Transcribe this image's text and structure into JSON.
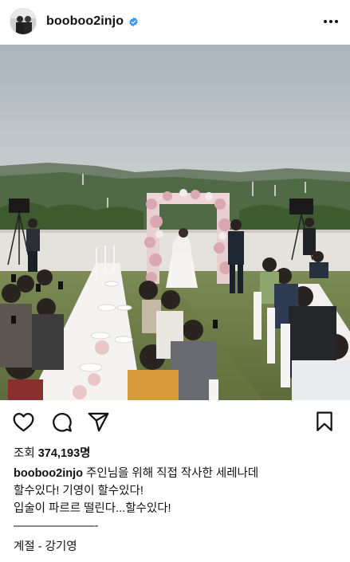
{
  "post": {
    "username": "booboo2injo",
    "verified": true
  },
  "icons": {
    "avatar": "avatar-photo",
    "verified": "verified-badge-icon",
    "more": "more-options-icon",
    "like": "heart-icon",
    "comment": "comment-icon",
    "share": "share-paper-plane-icon",
    "save": "bookmark-icon"
  },
  "colors": {
    "verified_badge": "#3897f0",
    "text": "#111111",
    "background": "#ffffff"
  },
  "stats": {
    "views_label": "조회",
    "views_count": "374,193명"
  },
  "caption": {
    "username": "booboo2injo",
    "line1": "주인님을 위해 직접 작사한 세레나데",
    "line2": "할수있다! 기영이 할수있다!",
    "line3": "입술이 파르르 떨린다...할수있다!",
    "line4": "———————-",
    "line5": "계절 - 강기영"
  }
}
